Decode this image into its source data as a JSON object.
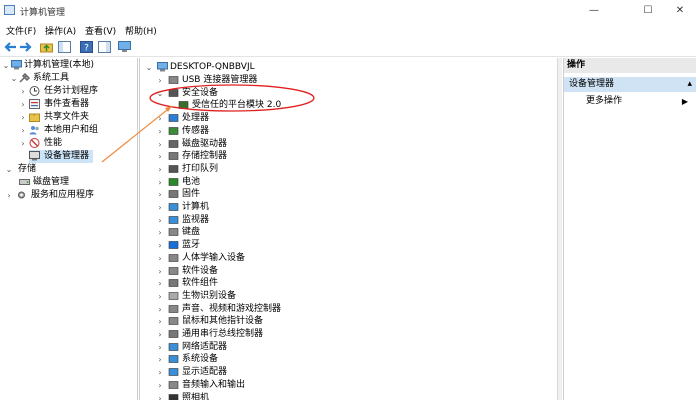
{
  "window": {
    "title": "计算机管理",
    "minimize": "—",
    "maximize": "☐",
    "close": "✕"
  },
  "menu": [
    {
      "label": "文件(F)"
    },
    {
      "label": "操作(A)"
    },
    {
      "label": "查看(V)"
    },
    {
      "label": "帮助(H)"
    }
  ],
  "left_tree": [
    {
      "label": "计算机管理(本地)"
    },
    {
      "label": "系统工具"
    },
    {
      "label": "任务计划程序"
    },
    {
      "label": "事件查看器"
    },
    {
      "label": "共享文件夹"
    },
    {
      "label": "本地用户和组"
    },
    {
      "label": "性能"
    },
    {
      "label": "设备管理器"
    },
    {
      "label": "存储"
    },
    {
      "label": "磁盘管理"
    },
    {
      "label": "服务和应用程序"
    }
  ],
  "device_tree": {
    "root": "DESKTOP-QNBBVJL",
    "items": [
      {
        "label": "USB 连接器管理器"
      },
      {
        "label": "安全设备"
      },
      {
        "label": "受信任的平台模块 2.0"
      },
      {
        "label": "处理器"
      },
      {
        "label": "传感器"
      },
      {
        "label": "磁盘驱动器"
      },
      {
        "label": "存储控制器"
      },
      {
        "label": "打印队列"
      },
      {
        "label": "电池"
      },
      {
        "label": "固件"
      },
      {
        "label": "计算机"
      },
      {
        "label": "监视器"
      },
      {
        "label": "键盘"
      },
      {
        "label": "蓝牙"
      },
      {
        "label": "人体学输入设备"
      },
      {
        "label": "软件设备"
      },
      {
        "label": "软件组件"
      },
      {
        "label": "生物识别设备"
      },
      {
        "label": "声音、视频和游戏控制器"
      },
      {
        "label": "鼠标和其他指针设备"
      },
      {
        "label": "通用串行总线控制器"
      },
      {
        "label": "网络适配器"
      },
      {
        "label": "系统设备"
      },
      {
        "label": "显示适配器"
      },
      {
        "label": "音频输入和输出"
      },
      {
        "label": "照相机"
      }
    ]
  },
  "actions": {
    "header": "操作",
    "group": "设备管理器",
    "more": "更多操作"
  },
  "colors": {
    "selection": "#cce4f7",
    "annotation": "#e02020",
    "arrow": "#f08a40"
  }
}
